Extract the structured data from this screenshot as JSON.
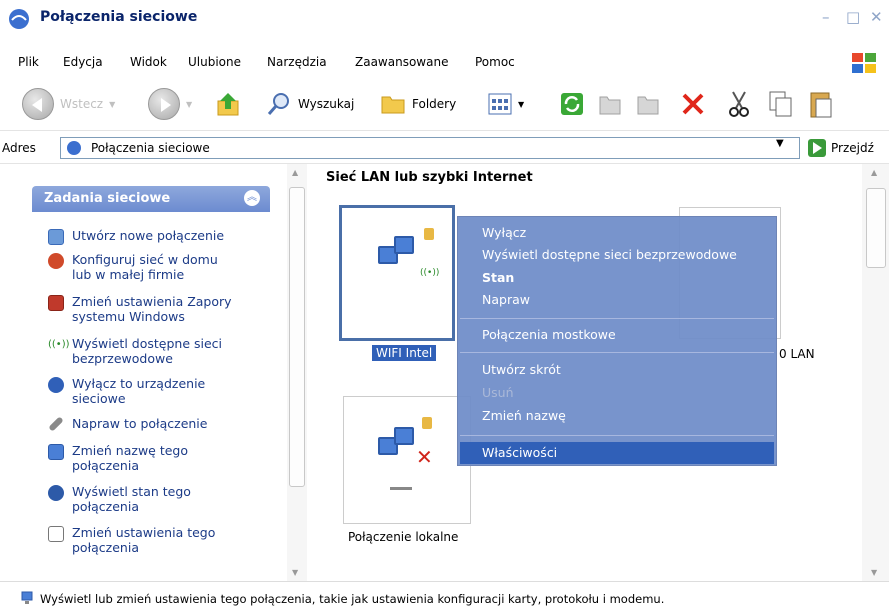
{
  "window": {
    "title": "Połączenia sieciowe",
    "minimize_glyph": "–",
    "maximize_glyph": "□",
    "close_glyph": "✕"
  },
  "menu": [
    "Plik",
    "Edycja",
    "Widok",
    "Ulubione",
    "Narzędzia",
    "Zaawansowane",
    "Pomoc"
  ],
  "toolbar": {
    "back": "Wstecz",
    "search": "Wyszukaj",
    "folders": "Foldery"
  },
  "address": {
    "label": "Adres",
    "value": "Połączenia sieciowe",
    "go": "Przejdź"
  },
  "taskpane": {
    "header": "Zadania sieciowe",
    "tasks": [
      "Utwórz nowe połączenie",
      "Konfiguruj sieć w domu\nlub w małej firmie",
      "Zmień ustawienia Zapory\nsystemu Windows",
      "Wyświetl dostępne sieci\nbezprzewodowe",
      "Wyłącz to urządzenie\nsieciowe",
      "Napraw to połączenie",
      "Zmień nazwę tego\npołączenia",
      "Wyświetl stan tego\npołączenia",
      "Zmień ustawienia tego\npołączenia"
    ]
  },
  "main": {
    "group_title": "Sieć LAN lub szybki Internet",
    "connections": [
      {
        "label": "WIFI Intel",
        "selected": true
      },
      {
        "label": "0 LAN"
      },
      {
        "label": "Połączenie lokalne"
      }
    ]
  },
  "context_menu": [
    {
      "label": "Wyłącz"
    },
    {
      "label": "Wyświetl dostępne sieci bezprzewodowe"
    },
    {
      "label": "Stan",
      "bold": true
    },
    {
      "label": "Napraw"
    },
    {
      "label": "Połączenia mostkowe"
    },
    {
      "label": "Utwórz skrót"
    },
    {
      "label": "Usuń",
      "disabled": true
    },
    {
      "label": "Zmień nazwę"
    },
    {
      "label": "Właściwości",
      "selected": true
    }
  ],
  "status": "Wyświetl lub zmień ustawienia tego połączenia, takie jak ustawienia konfiguracji karty, protokołu i modemu.",
  "colors": {
    "task_link": "#1c3b87",
    "pane_header": "#6c8bd0",
    "menu_bg": "#6e8cc8",
    "selected": "#3060b8"
  }
}
